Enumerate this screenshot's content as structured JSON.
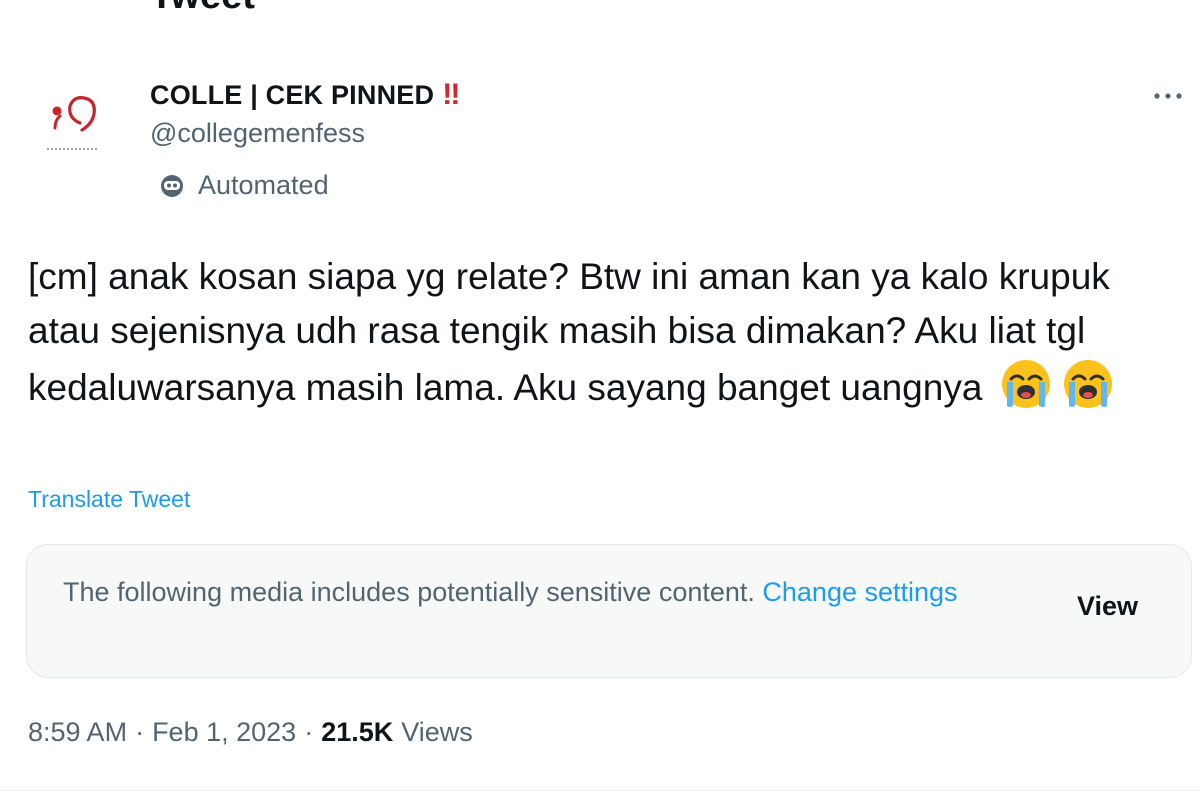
{
  "header": {
    "title": "Tweet"
  },
  "author": {
    "display_name": "COLLE | CEK PINNED",
    "badge_emoji": "‼",
    "handle": "@collegemenfess",
    "automated_label": "Automated",
    "avatar_logo": "COLLEGE"
  },
  "tweet": {
    "text": "[cm] anak kosan siapa yg relate? Btw ini aman kan ya kalo krupuk atau sejenisnya udh rasa tengik masih bisa dimakan? Aku liat tgl kedaluwarsanya masih lama. Aku sayang banget uangnya",
    "emojis": [
      "loudly-crying-face-icon",
      "loudly-crying-face-icon"
    ],
    "translate_label": "Translate Tweet"
  },
  "sensitive_media": {
    "message": "The following media includes potentially sensitive content. ",
    "change_settings_label": "Change settings",
    "view_label": "View"
  },
  "meta": {
    "time": "8:59 AM",
    "separator": "·",
    "date": "Feb 1, 2023",
    "views_count": "21.5K",
    "views_label": "Views"
  },
  "colors": {
    "accent": "#1d9bf0",
    "text_primary": "#0f1419",
    "text_secondary": "#536471",
    "badge_red": "#d7262e",
    "media_box_bg": "#f7f9f9"
  }
}
